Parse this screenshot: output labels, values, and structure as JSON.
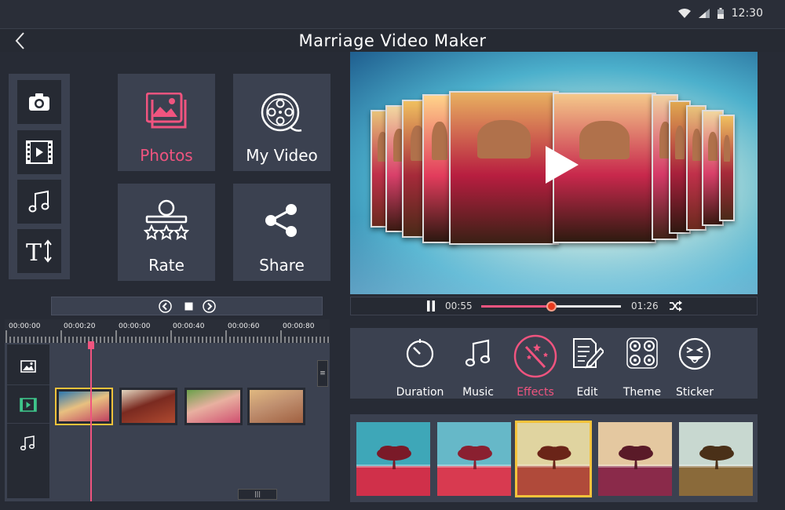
{
  "status_bar": {
    "time": "12:30",
    "icons": [
      "wifi-icon",
      "signal-icon",
      "battery-icon"
    ]
  },
  "header": {
    "title": "Marriage Video Maker",
    "back_icon": "back-arrow-icon"
  },
  "tools": [
    {
      "name": "camera-icon"
    },
    {
      "name": "video-clip-icon"
    },
    {
      "name": "music-note-icon"
    },
    {
      "name": "text-size-icon"
    }
  ],
  "menu": {
    "photos": {
      "label": "Photos",
      "icon": "photos-icon"
    },
    "my_video": {
      "label": "My Video",
      "icon": "film-reel-icon"
    },
    "rate": {
      "label": "Rate",
      "icon": "rate-stars-icon"
    },
    "share": {
      "label": "Share",
      "icon": "share-icon"
    }
  },
  "player": {
    "current_time": "00:55",
    "total_time": "01:26",
    "progress": 0.5
  },
  "timeline": {
    "ticks": [
      "00:00:00",
      "00:00:20",
      "00:00:00",
      "00:00:40",
      "00:00:60",
      "00:00:80"
    ],
    "selected_clip": 0
  },
  "effects_toolbar": {
    "items": [
      {
        "label": "Duration",
        "icon": "timer-icon"
      },
      {
        "label": "Music",
        "icon": "music-note-icon"
      },
      {
        "label": "Effects",
        "icon": "magic-wand-icon",
        "active": true
      },
      {
        "label": "Edit",
        "icon": "edit-pencil-icon"
      },
      {
        "label": "Theme",
        "icon": "theme-grid-icon"
      },
      {
        "label": "Sticker",
        "icon": "sticker-face-icon"
      }
    ]
  },
  "filters": {
    "count": 5,
    "selected": 2
  },
  "colors": {
    "accent": "#f0547f",
    "panel": "#3b4150",
    "dark": "#262a33",
    "highlight": "#f5c33b"
  }
}
